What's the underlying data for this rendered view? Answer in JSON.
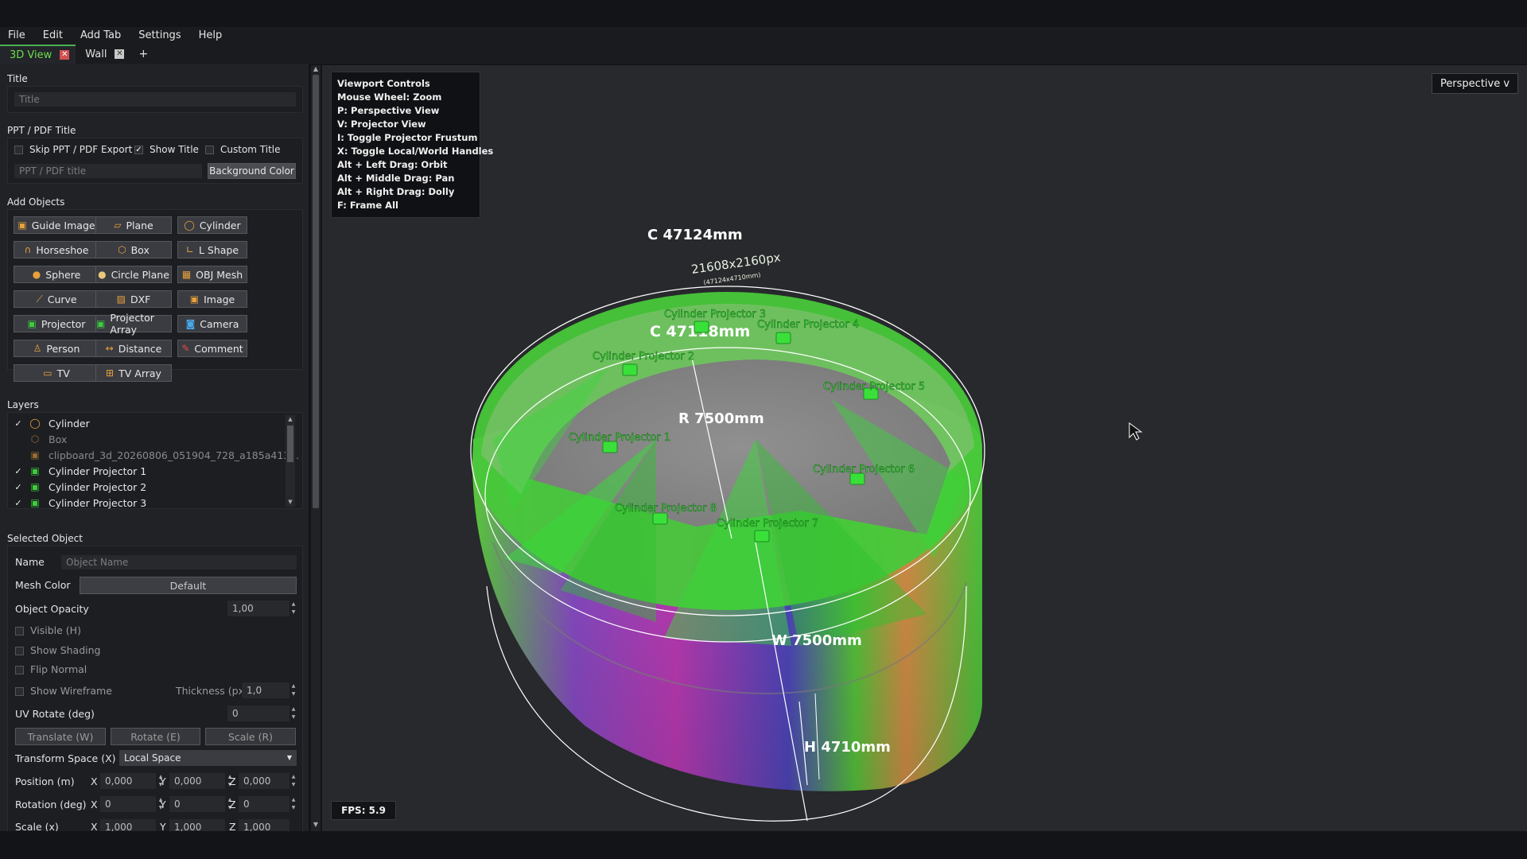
{
  "menu": [
    "File",
    "Edit",
    "Add Tab",
    "Settings",
    "Help"
  ],
  "tabs": [
    {
      "label": "3D View",
      "active": true
    },
    {
      "label": "Wall",
      "active": false
    }
  ],
  "tab_add": "+",
  "title_section": {
    "heading": "Title",
    "placeholder": "Title"
  },
  "ppt_section": {
    "heading": "PPT / PDF Title",
    "skip_label": "Skip PPT / PDF Export",
    "skip_checked": false,
    "show_title_label": "Show Title",
    "show_title_checked": true,
    "custom_title_label": "Custom Title",
    "custom_title_checked": false,
    "placeholder": "PPT / PDF title",
    "bg_color_button": "Background Color"
  },
  "add_objects": {
    "heading": "Add Objects",
    "buttons": [
      {
        "label": "Guide Image",
        "icon": "image-icon",
        "glyph": "▣",
        "color": "#e8a13a"
      },
      {
        "label": "Plane",
        "icon": "plane-icon",
        "glyph": "▱",
        "color": "#e8a13a"
      },
      {
        "label": "Cylinder",
        "icon": "cylinder-icon",
        "glyph": "◯",
        "color": "#e8a13a"
      },
      {
        "label": "Horseshoe",
        "icon": "horseshoe-icon",
        "glyph": "∩",
        "color": "#e8a13a"
      },
      {
        "label": "Box",
        "icon": "box-icon",
        "glyph": "⬡",
        "color": "#e8a13a"
      },
      {
        "label": "L Shape",
        "icon": "lshape-icon",
        "glyph": "∟",
        "color": "#e8a13a"
      },
      {
        "label": "Sphere",
        "icon": "sphere-icon",
        "glyph": "●",
        "color": "#e8a13a"
      },
      {
        "label": "Circle Plane",
        "icon": "circle-plane-icon",
        "glyph": "●",
        "color": "#e8c87a"
      },
      {
        "label": "OBJ Mesh",
        "icon": "mesh-icon",
        "glyph": "▦",
        "color": "#e8a13a"
      },
      {
        "label": "Curve",
        "icon": "curve-icon",
        "glyph": "⟋",
        "color": "#e8a13a"
      },
      {
        "label": "DXF",
        "icon": "dxf-icon",
        "glyph": "▨",
        "color": "#e8a13a"
      },
      {
        "label": "Image",
        "icon": "picture-icon",
        "glyph": "▣",
        "color": "#e8a13a"
      },
      {
        "label": "Projector",
        "icon": "projector-icon",
        "glyph": "▣",
        "color": "#3ccf3c"
      },
      {
        "label": "Projector Array",
        "icon": "projector-array-icon",
        "glyph": "▣",
        "color": "#3ccf3c"
      },
      {
        "label": "Camera",
        "icon": "camera-icon",
        "glyph": "◙",
        "color": "#4aa8e8"
      },
      {
        "label": "Person",
        "icon": "person-icon",
        "glyph": "♙",
        "color": "#e8a13a"
      },
      {
        "label": "Distance",
        "icon": "distance-icon",
        "glyph": "↔",
        "color": "#e8a13a"
      },
      {
        "label": "Comment",
        "icon": "comment-icon",
        "glyph": "✎",
        "color": "#e84a4a"
      },
      {
        "label": "TV",
        "icon": "tv-icon",
        "glyph": "▭",
        "color": "#e8a13a"
      },
      {
        "label": "TV Array",
        "icon": "tv-array-icon",
        "glyph": "⊞",
        "color": "#e8a13a"
      }
    ]
  },
  "layers": {
    "heading": "Layers",
    "items": [
      {
        "name": "Cylinder",
        "checked": true,
        "icon": "cylinder-icon",
        "glyph": "◯",
        "color": "#e8a13a",
        "dim": false
      },
      {
        "name": "Box",
        "checked": false,
        "icon": "box-icon",
        "glyph": "⬡",
        "color": "#e8a13a",
        "dim": true
      },
      {
        "name": "clipboard_3d_20260806_051904_728_a185a413...",
        "checked": false,
        "icon": "image-icon",
        "glyph": "▣",
        "color": "#e8a13a",
        "dim": true
      },
      {
        "name": "Cylinder Projector 1",
        "checked": true,
        "icon": "projector-icon",
        "glyph": "▣",
        "color": "#3ccf3c",
        "dim": false
      },
      {
        "name": "Cylinder Projector 2",
        "checked": true,
        "icon": "projector-icon",
        "glyph": "▣",
        "color": "#3ccf3c",
        "dim": false
      },
      {
        "name": "Cylinder Projector 3",
        "checked": true,
        "icon": "projector-icon",
        "glyph": "▣",
        "color": "#3ccf3c",
        "dim": false
      }
    ]
  },
  "selected": {
    "heading": "Selected Object",
    "name_label": "Name",
    "name_placeholder": "Object Name",
    "mesh_color_label": "Mesh Color",
    "mesh_color_value": "Default",
    "opacity_label": "Object Opacity",
    "opacity_value": "1,00",
    "visible_label": "Visible (H)",
    "shading_label": "Show Shading",
    "flip_label": "Flip Normal",
    "wireframe_label": "Show Wireframe",
    "thickness_label": "Thickness (px)",
    "thickness_value": "1,0",
    "uv_label": "UV Rotate (deg)",
    "uv_value": "0",
    "translate_btn": "Translate (W)",
    "rotate_btn": "Rotate (E)",
    "scale_btn": "Scale (R)",
    "transform_label": "Transform Space (X)",
    "transform_value": "Local Space",
    "position_label": "Position (m)",
    "position": [
      "0,000",
      "0,000",
      "0,000"
    ],
    "rotation_label": "Rotation (deg)",
    "rotation": [
      "0",
      "0",
      "0"
    ],
    "scale_label": "Scale (x)",
    "scale": [
      "1,000",
      "1,000",
      "1,000"
    ],
    "axis_x": "X",
    "axis_y": "Y",
    "axis_z": "Z"
  },
  "viewport": {
    "controls": [
      "Viewport Controls",
      "Mouse Wheel: Zoom",
      "P: Perspective View",
      "V: Projector View",
      "I: Toggle Projector Frustum",
      "X: Toggle Local/World Handles",
      "Alt + Left Drag: Orbit",
      "Alt + Middle Drag: Pan",
      "Alt + Right Drag: Dolly",
      "F: Frame All"
    ],
    "view_mode": "Perspective v",
    "fps": "FPS: 5.9",
    "dim_c_outer": "C 47124mm",
    "dim_c_inner": "C 47118mm",
    "dim_r": "R 7500mm",
    "dim_w": "W 7500mm",
    "dim_h": "H 4710mm",
    "resolution_label": "21608x2160px",
    "resolution_sub": "(47124x4710mm)",
    "projectors": [
      "Cylinder Projector 1",
      "Cylinder Projector 2",
      "Cylinder Projector 3",
      "Cylinder Projector 4",
      "Cylinder Projector 5",
      "Cylinder Projector 6",
      "Cylinder Projector 7",
      "Cylinder Projector 8"
    ],
    "projector_color": "#3ae03a"
  }
}
